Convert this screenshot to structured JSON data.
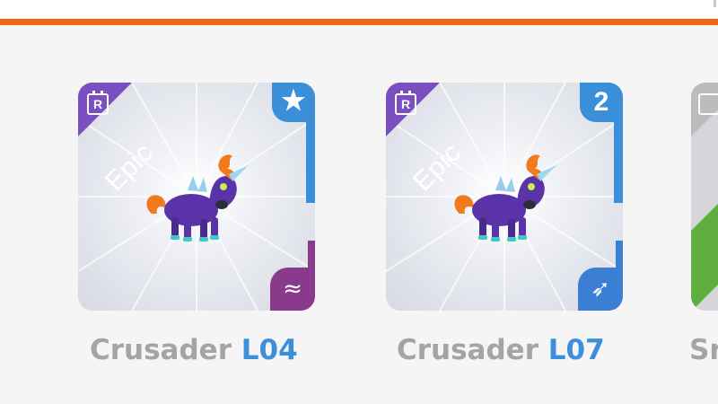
{
  "cards": [
    {
      "rarity_label": "Epic",
      "type_badge": "R",
      "top_right_icon": "star-icon",
      "top_right_text": "★",
      "bottom_right_icon": "water-wave-icon",
      "bottom_right_text": "≈",
      "name": "Crusader",
      "level": "L04"
    },
    {
      "rarity_label": "Epic",
      "type_badge": "R",
      "top_right_icon": "count-badge",
      "top_right_text": "2",
      "bottom_right_icon": "archer-arrow-icon",
      "bottom_right_text": "➶",
      "name": "Crusader",
      "level": "L07"
    }
  ],
  "partial_card": {
    "name_fragment": "Sr"
  },
  "colors": {
    "accent_orange": "#ef6414",
    "epic_ribbon": "#f07878",
    "corner_purple": "#7a4fc0",
    "level_blue": "#3d8fdc",
    "name_gray": "#a4a4a4"
  }
}
